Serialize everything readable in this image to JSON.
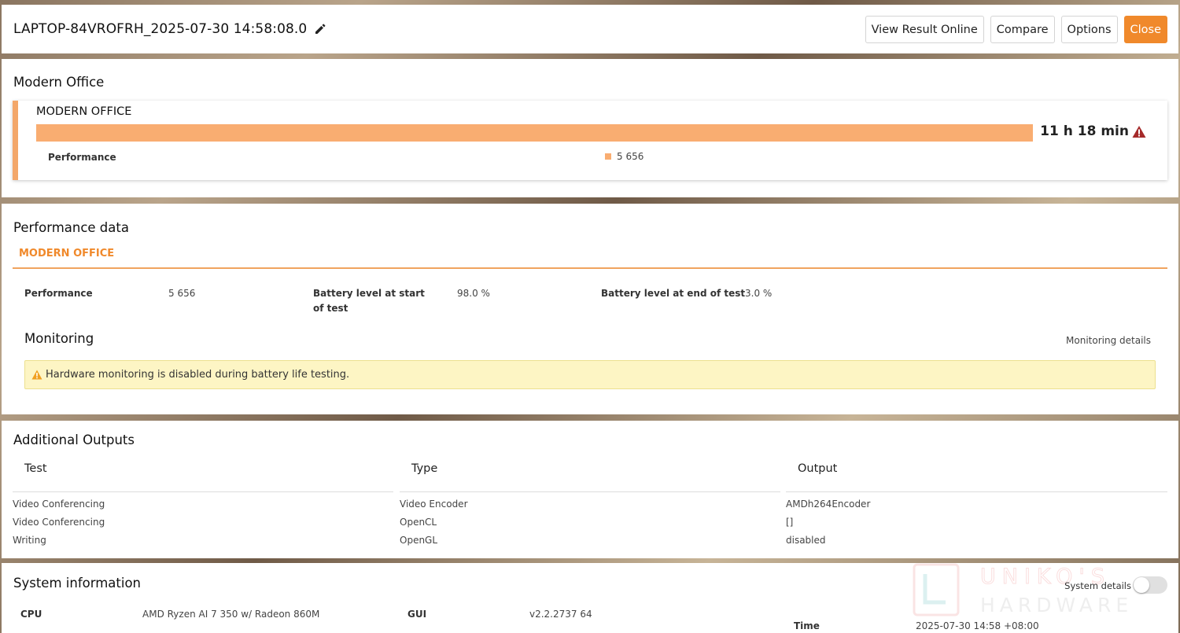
{
  "header": {
    "title": "LAPTOP-84VROFRH_2025-07-30 14:58:08.0",
    "buttons": {
      "view_online": "View Result Online",
      "compare": "Compare",
      "options": "Options",
      "close": "Close"
    },
    "accent_color": "#f0892b"
  },
  "benchmark": {
    "section_title": "Modern Office",
    "card_title": "MODERN OFFICE",
    "score": "11 h 18 min",
    "bar_fill_fraction": 1.0,
    "perf_label": "Performance",
    "perf_value": "5 656",
    "bar_color": "#f9ad71"
  },
  "performance_data": {
    "section_title": "Performance data",
    "tab": "MODERN OFFICE",
    "items": [
      {
        "label": "Performance",
        "value": "5 656"
      },
      {
        "label": "Battery level at start of test",
        "value": "98.0 %"
      },
      {
        "label": "Battery level at end of test",
        "value": "3.0 %"
      }
    ],
    "monitoring_title": "Monitoring",
    "monitoring_link": "Monitoring details",
    "alert_text": "Hardware monitoring is disabled during battery life testing."
  },
  "additional_outputs": {
    "section_title": "Additional Outputs",
    "columns": [
      "Test",
      "Type",
      "Output"
    ],
    "rows": [
      [
        "Video Conferencing",
        "Video Encoder",
        "AMDh264Encoder"
      ],
      [
        "Video Conferencing",
        "OpenCL",
        "[]"
      ],
      [
        "Writing",
        "OpenGL",
        "disabled"
      ]
    ]
  },
  "system_info": {
    "section_title": "System information",
    "toggle_label": "System details",
    "toggle_on": false,
    "items": [
      {
        "label": "CPU",
        "value": "AMD Ryzen AI 7 350 w/ Radeon 860M"
      },
      {
        "label": "GUI",
        "value": "v2.2.2737 64"
      },
      {
        "label": "Time",
        "value": "2025-07-30 14:58 +08:00"
      }
    ]
  },
  "watermark": {
    "line1": "UNIKO'S",
    "line2": "HARDWARE"
  }
}
